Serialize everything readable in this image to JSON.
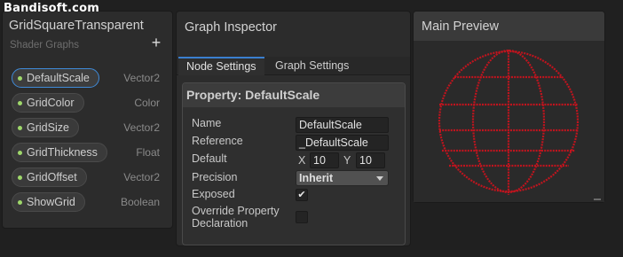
{
  "watermark": "Bandisoft.com",
  "blackboard": {
    "title": "GridSquareTransparent",
    "subtitle": "Shader Graphs",
    "add_label": "+",
    "properties": [
      {
        "name": "DefaultScale",
        "type": "Vector2",
        "selected": true
      },
      {
        "name": "GridColor",
        "type": "Color",
        "selected": false
      },
      {
        "name": "GridSize",
        "type": "Vector2",
        "selected": false
      },
      {
        "name": "GridThickness",
        "type": "Float",
        "selected": false
      },
      {
        "name": "GridOffset",
        "type": "Vector2",
        "selected": false
      },
      {
        "name": "ShowGrid",
        "type": "Boolean",
        "selected": false
      }
    ]
  },
  "inspector": {
    "title": "Graph Inspector",
    "tabs": [
      {
        "label": "Node Settings",
        "active": true
      },
      {
        "label": "Graph Settings",
        "active": false
      }
    ],
    "property_header": "Property: DefaultScale",
    "fields": {
      "name_label": "Name",
      "name_value": "DefaultScale",
      "reference_label": "Reference",
      "reference_value": "_DefaultScale",
      "default_label": "Default",
      "x_label": "X",
      "x_value": "10",
      "y_label": "Y",
      "y_value": "10",
      "precision_label": "Precision",
      "precision_value": "Inherit",
      "exposed_label": "Exposed",
      "exposed_checked": true,
      "override_label_1": "Override Property",
      "override_label_2": "Declaration",
      "override_checked": false
    }
  },
  "preview": {
    "title": "Main Preview",
    "grid_color": "#c0141e"
  }
}
